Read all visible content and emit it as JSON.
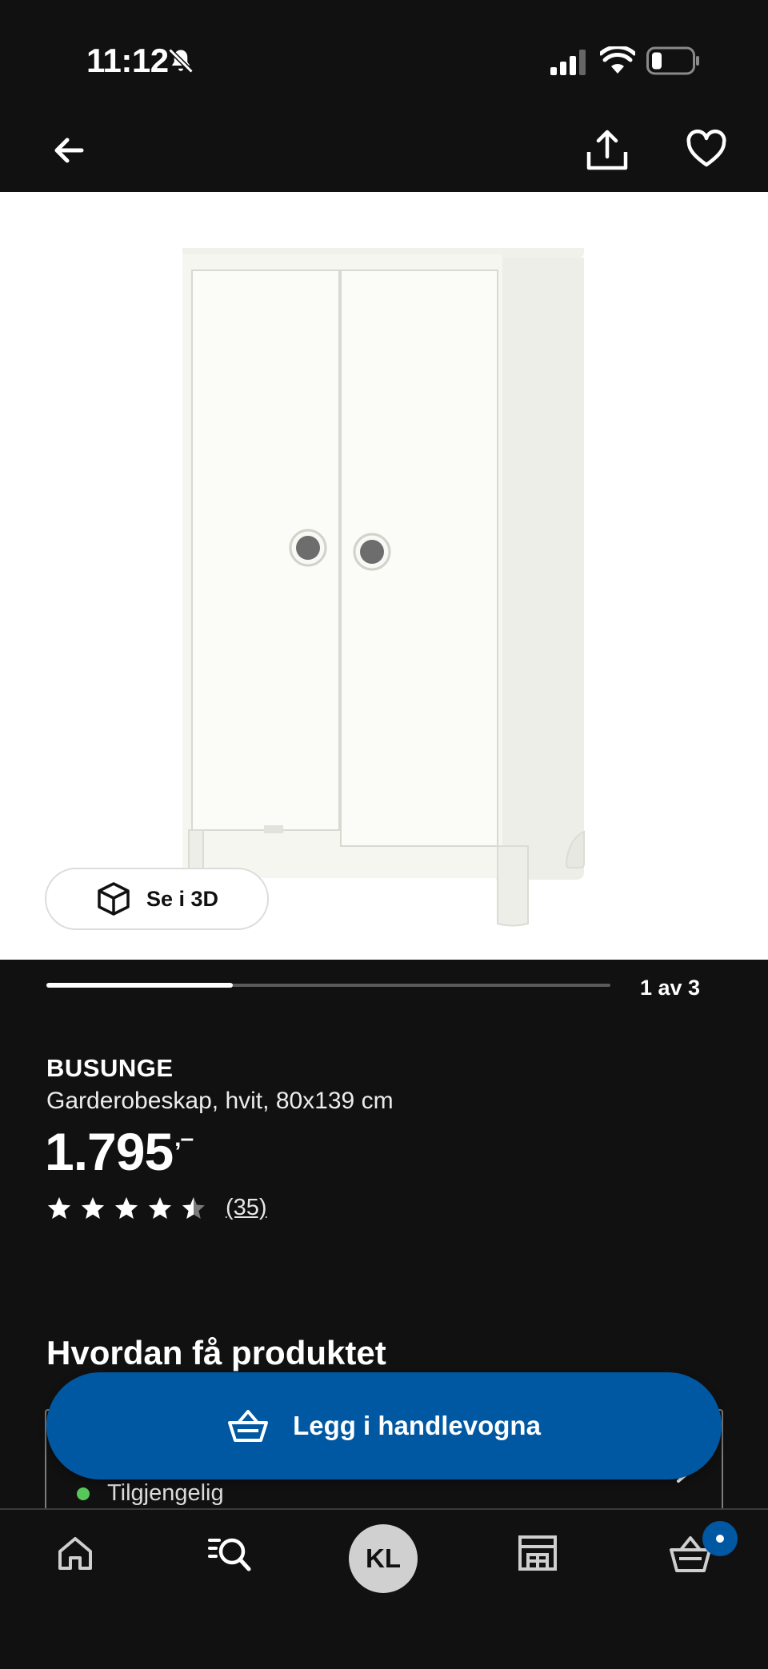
{
  "status_bar": {
    "time": "11:12",
    "icons": [
      "bell-slash-icon",
      "signal-icon",
      "wifi-icon",
      "battery-icon"
    ],
    "battery_level": 0.25
  },
  "top_nav": {
    "icons": [
      "back-arrow-icon",
      "share-icon",
      "heart-icon"
    ]
  },
  "gallery": {
    "view_3d_label": "Se i 3D",
    "counter": "1 av 3",
    "progress": 0.33
  },
  "product": {
    "name": "BUSUNGE",
    "description": "Garderobeskap, hvit, 80x139 cm",
    "price": "1.795",
    "price_suffix": ",–",
    "rating": 4.5,
    "rating_max": 5,
    "review_count": "(35)"
  },
  "delivery": {
    "section_title": "Hvordan få produktet",
    "availability": "Tilgjengelig",
    "availability_color": "#57c75a"
  },
  "cta": {
    "add_to_cart_label": "Legg i handlevogna",
    "color": "#0058a3"
  },
  "tab_bar": {
    "profile_initials": "KL",
    "tabs": [
      "home-icon",
      "search-icon",
      "profile-avatar",
      "store-icon",
      "cart-icon"
    ],
    "cart_has_items": true
  }
}
